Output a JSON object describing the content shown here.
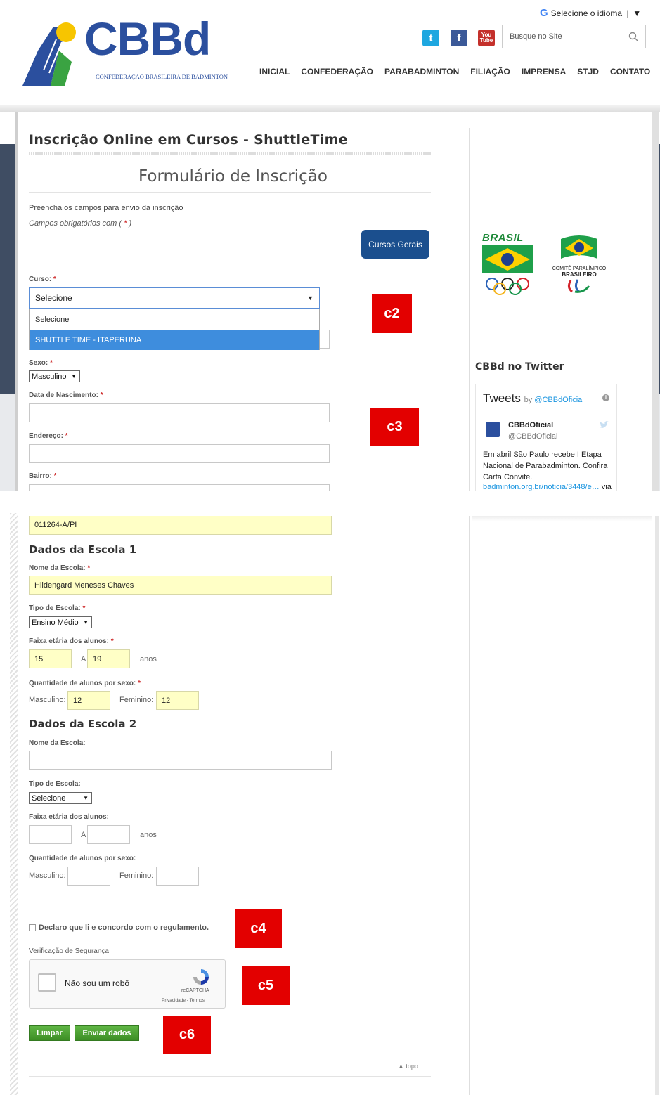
{
  "header": {
    "language": "Selecione o idioma",
    "language_arrow": "▼",
    "logo_text": "CBBd",
    "logo_subtitle": "CONFEDERAÇÃO BRASILEIRA DE BADMINTON",
    "search_placeholder": "Busque no Site",
    "social": {
      "twitter": "t",
      "facebook": "f",
      "youtube": "You Tube"
    },
    "nav": [
      "INICIAL",
      "CONFEDERAÇÃO",
      "PARABADMINTON",
      "FILIAÇÃO",
      "IMPRENSA",
      "STJD",
      "CONTATO"
    ]
  },
  "page": {
    "title": "Inscrição Online em Cursos - ShuttleTime",
    "form_title": "Formulário de Inscrição",
    "intro": "Preencha os campos para envio da inscrição",
    "required_note_prefix": "Campos obrigatórios com (",
    "required_note_star": " * ",
    "required_note_suffix": ")",
    "cursos_button": "Cursos Gerais"
  },
  "form": {
    "curso_label": "Curso:",
    "curso_selected": "Selecione",
    "curso_options": [
      "Selecione",
      "SHUTTLE TIME - ITAPERUNA"
    ],
    "sexo_label": "Sexo:",
    "sexo_value": "Masculino",
    "nascimento_label": "Data de Nascimento:",
    "endereco_label": "Endereço:",
    "bairro_label": "Bairro:",
    "registro_value": "011264-A/PI",
    "star": "*"
  },
  "escola1": {
    "title": "Dados da Escola 1",
    "nome_label": "Nome da Escola:",
    "nome_value": "Hildengard Meneses Chaves",
    "tipo_label": "Tipo de Escola:",
    "tipo_value": "Ensino Médio",
    "faixa_label": "Faixa etária dos alunos:",
    "faixa_de": "15",
    "faixa_a_label": "A",
    "faixa_ate": "19",
    "faixa_unit": "anos",
    "qtd_label": "Quantidade de alunos por sexo:",
    "masc_label": "Masculino:",
    "masc_value": "12",
    "fem_label": "Feminino:",
    "fem_value": "12"
  },
  "escola2": {
    "title": "Dados da Escola 2",
    "nome_label": "Nome da Escola:",
    "tipo_label": "Tipo de Escola:",
    "tipo_value": "Selecione",
    "faixa_label": "Faixa etária dos alunos:",
    "faixa_a_label": "A",
    "faixa_unit": "anos",
    "qtd_label": "Quantidade de alunos por sexo:",
    "masc_label": "Masculino:",
    "fem_label": "Feminino:"
  },
  "footer_form": {
    "declaro_prefix": "Declaro que li e concordo com o ",
    "declaro_link": "regulamento",
    "declaro_suffix": ".",
    "seguranca_label": "Verificação de Segurança",
    "captcha_text": "Não sou um robô",
    "captcha_brand": "reCAPTCHA",
    "captcha_links": "Privacidade - Termos",
    "btn_limpar": "Limpar",
    "btn_enviar": "Enviar dados",
    "topo": "▲ topo"
  },
  "sidebar": {
    "brasil": "BRASIL",
    "cpb_line1": "COMITÊ PARALÍMPICO",
    "cpb_line2": "BRASILEIRO",
    "twitter_title": "CBBd no Twitter",
    "tweets_label": "Tweets",
    "tweets_by": "by",
    "tweets_handle": "@CBBdOficial",
    "tweet_name": "CBBdOficial",
    "tweet_user": "@CBBdOficial",
    "tweet_text": "Em abril São Paulo recebe I Etapa Nacional de Parabadminton. Confira Carta Convite.",
    "tweet_link": "badminton.org.br/noticia/3448/e…",
    "tweet_via": " via"
  },
  "tags": {
    "c2": "c2",
    "c3": "c3",
    "c4": "c4",
    "c5": "c5",
    "c6": "c6"
  },
  "colors": {
    "brand_blue": "#2b4f9e",
    "nav_button": "#1b4f8e",
    "tag_red": "#e30000",
    "submit_green": "#4ca232",
    "filled_yellow": "#ffffc6"
  }
}
